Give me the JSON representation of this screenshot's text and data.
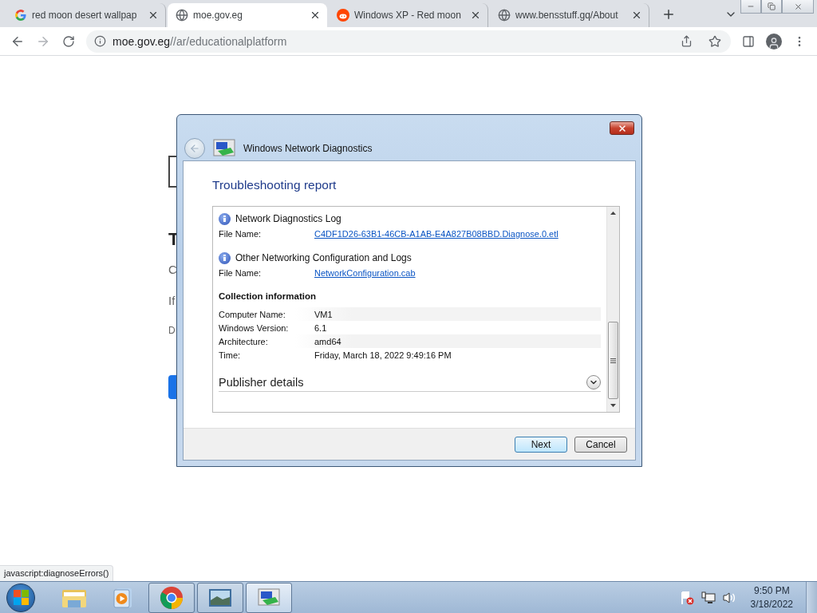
{
  "browser": {
    "tabs": [
      {
        "title": "red moon desert wallpap",
        "kind": "google",
        "selected": false
      },
      {
        "title": "moe.gov.eg",
        "kind": "site",
        "selected": true
      },
      {
        "title": "Windows XP - Red moon",
        "kind": "reddit",
        "selected": false
      },
      {
        "title": "www.bensstuff.gq/About",
        "kind": "site",
        "selected": false
      }
    ],
    "address": {
      "host": "moe.gov.eg",
      "path": "//ar/educationalplatform"
    },
    "status_url": "javascript:diagnoseErrors()"
  },
  "page_fragments": [
    {
      "kind": "heading",
      "text": "T"
    },
    {
      "kind": "text",
      "text": "C"
    },
    {
      "kind": "text",
      "text": "If"
    },
    {
      "kind": "small",
      "text": "D"
    }
  ],
  "dialog": {
    "title": "Windows Network Diagnostics",
    "heading": "Troubleshooting report",
    "files": [
      {
        "title": "Network Diagnostics Log",
        "label": "File Name:",
        "link": "C4DF1D26-63B1-46CB-A1AB-E4A827B08BBD.Diagnose.0.etl"
      },
      {
        "title": "Other Networking Configuration and Logs",
        "label": "File Name:",
        "link": "NetworkConfiguration.cab"
      }
    ],
    "collection": {
      "title": "Collection information",
      "rows": [
        {
          "label": "Computer Name:",
          "value": "VM1"
        },
        {
          "label": "Windows Version:",
          "value": "6.1"
        },
        {
          "label": "Architecture:",
          "value": "amd64"
        },
        {
          "label": "Time:",
          "value": "Friday, March 18, 2022 9:49:16 PM"
        }
      ]
    },
    "publisher": {
      "title": "Publisher details",
      "expanded": false
    },
    "buttons": [
      {
        "label": "Next",
        "default": true
      },
      {
        "label": "Cancel",
        "default": false
      }
    ]
  },
  "taskbar": {
    "items": [
      {
        "kind": "explorer",
        "running": false,
        "active": false
      },
      {
        "kind": "media",
        "running": false,
        "active": false
      },
      {
        "kind": "chrome",
        "running": true,
        "active": false
      },
      {
        "kind": "photo",
        "running": true,
        "active": false
      },
      {
        "kind": "diagnostics",
        "running": true,
        "active": true
      }
    ],
    "time": "9:50 PM",
    "date": "3/18/2022"
  }
}
